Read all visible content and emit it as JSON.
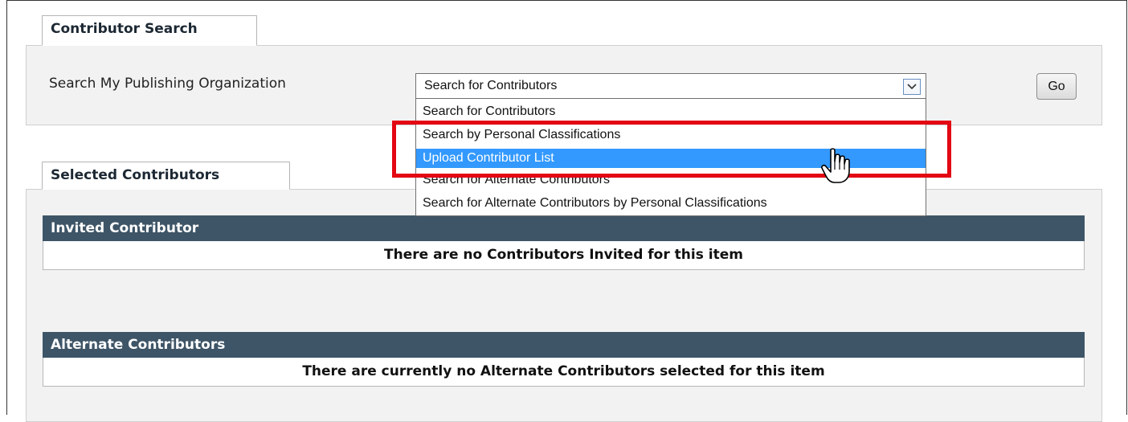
{
  "contributor_search": {
    "title": "Contributor Search",
    "label": "Search My Publishing Organization",
    "select": {
      "selected": "Search for Contributors",
      "options": [
        "Search for Contributors",
        "Search by Personal Classifications",
        "Upload Contributor List",
        "Search for Alternate Contributors",
        "Search for Alternate Contributors by Personal Classifications"
      ],
      "highlighted_option": "Upload Contributor List"
    },
    "go_label": "Go"
  },
  "selected_contributors": {
    "title": "Selected Contributors",
    "invited": {
      "header": "Invited Contributor",
      "message": "There are no Contributors Invited for this item"
    },
    "alternate": {
      "header": "Alternate Contributors",
      "message": "There are currently no Alternate Contributors selected for this item"
    }
  },
  "colors": {
    "header_bar": "#3e5567",
    "highlight_option": "#3399ff",
    "annotation_box": "#e30613",
    "panel_bg": "#f2f2f2"
  },
  "icons": {
    "dropdown_arrow": "chevron-down-icon",
    "cursor": "hand-pointer-icon"
  }
}
